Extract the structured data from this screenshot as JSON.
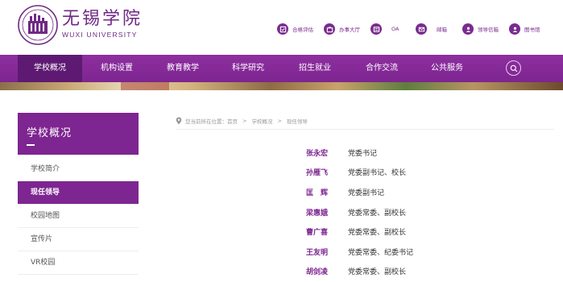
{
  "header": {
    "logo_cn": "无锡学院",
    "logo_en": "WUXI UNIVERSITY",
    "top_links": [
      {
        "label": "合格评估",
        "icon": "assessment-icon"
      },
      {
        "label": "办事大厅",
        "icon": "hall-icon"
      },
      {
        "label": "OA",
        "icon": "oa-icon"
      },
      {
        "label": "邮箱",
        "icon": "mail-icon"
      },
      {
        "label": "领导信箱",
        "icon": "leader-mailbox-icon"
      },
      {
        "label": "图书馆",
        "icon": "library-icon"
      }
    ]
  },
  "nav": {
    "items": [
      "学校概况",
      "机构设置",
      "教育教学",
      "科学研究",
      "招生就业",
      "合作交流",
      "公共服务"
    ],
    "active": "学校概况",
    "search_icon": "search-icon"
  },
  "sidebar": {
    "title": "学校概况",
    "items": [
      {
        "label": "学校简介",
        "active": false
      },
      {
        "label": "现任领导",
        "active": true
      },
      {
        "label": "校园地图",
        "active": false
      },
      {
        "label": "宣传片",
        "active": false
      },
      {
        "label": "VR校园",
        "active": false
      }
    ]
  },
  "breadcrumb": {
    "prefix": "您当前所在位置：",
    "items": [
      "首页",
      "学校概况",
      "现任领导"
    ],
    "separator": ">"
  },
  "leaders": [
    {
      "name": "张永宏",
      "position": "党委书记"
    },
    {
      "name": "孙雁飞",
      "position": "党委副书记、校长"
    },
    {
      "name": "匡　辉",
      "position": "党委副书记"
    },
    {
      "name": "梁惠娥",
      "position": "党委常委、副校长"
    },
    {
      "name": "曹广喜",
      "position": "党委常委、副校长"
    },
    {
      "name": "王友明",
      "position": "党委常委、纪委书记"
    },
    {
      "name": "胡剑凌",
      "position": "党委常委、副校长"
    }
  ],
  "colors": {
    "primary": "#7d2590",
    "primary_dark": "#5e1a72",
    "text": "#333333",
    "muted": "#999999"
  }
}
